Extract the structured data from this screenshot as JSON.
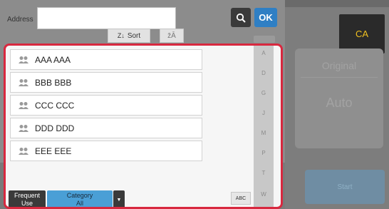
{
  "address": {
    "label": "Address",
    "value": ""
  },
  "search": {
    "icon": "search-icon"
  },
  "ok": {
    "label": "OK"
  },
  "sort": {
    "label": "Sort",
    "icon": "sort-icon"
  },
  "ca": {
    "label": "CA"
  },
  "original": {
    "label": "Original",
    "value": "Auto"
  },
  "start": {
    "label": "Start"
  },
  "list": {
    "items": [
      {
        "label": "AAA AAA",
        "icon": "group-icon"
      },
      {
        "label": "BBB BBB",
        "icon": "group-icon"
      },
      {
        "label": "CCC CCC",
        "icon": "group-icon"
      },
      {
        "label": "DDD DDD",
        "icon": "group-icon"
      },
      {
        "label": "EEE EEE",
        "icon": "group-icon"
      }
    ]
  },
  "alphabet": [
    "A",
    "D",
    "G",
    "J",
    "M",
    "P",
    "T",
    "W"
  ],
  "abc": {
    "label": "ABC"
  },
  "frequent": {
    "line1": "Frequent",
    "line2": "Use"
  },
  "category": {
    "line1": "Category",
    "line2": "All"
  },
  "colors": {
    "accent": "#2f7fc4",
    "highlight": "#d8283f",
    "ca_text": "#f0c020"
  }
}
